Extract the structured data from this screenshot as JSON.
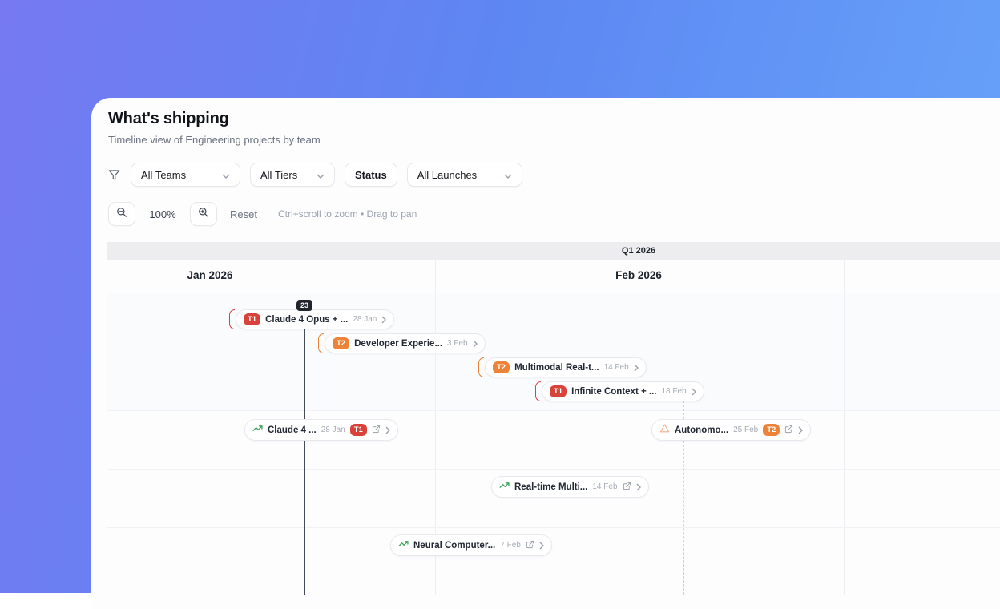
{
  "header": {
    "title": "What's shipping",
    "subtitle": "Timeline view of Engineering projects by team"
  },
  "filters": {
    "teams_label": "All Teams",
    "tiers_label": "All Tiers",
    "status_label": "Status",
    "launches_label": "All Launches"
  },
  "zoom_controls": {
    "level": "100%",
    "reset_label": "Reset",
    "hint": "Ctrl+scroll to zoom • Drag to pan"
  },
  "timeline": {
    "quarter_label": "Q1 2026",
    "months": [
      "Jan 2026",
      "Feb 2026"
    ],
    "today_label": "23",
    "projects": [
      {
        "tier": "T1",
        "name": "Claude 4 Opus + ...",
        "date": "28 Jan"
      },
      {
        "tier": "T2",
        "name": "Developer Experie...",
        "date": "3 Feb"
      },
      {
        "tier": "T2",
        "name": "Multimodal Real-t...",
        "date": "14 Feb"
      },
      {
        "tier": "T1",
        "name": "Infinite Context + ...",
        "date": "18 Feb"
      }
    ],
    "launches": [
      {
        "icon": "trending-up-icon",
        "name": "Claude 4 ...",
        "date": "28 Jan",
        "tier": "T1"
      },
      {
        "icon": "warning-triangle-icon",
        "name": "Autonomo...",
        "date": "25 Feb",
        "tier": "T2"
      },
      {
        "icon": "trending-up-icon",
        "name": "Real-time Multi...",
        "date": "14 Feb"
      },
      {
        "icon": "trending-up-icon",
        "name": "Neural Computer...",
        "date": "7 Feb"
      }
    ]
  },
  "icons": {
    "filter": "funnel",
    "zoom_out": "magnifier-minus",
    "zoom_in": "magnifier-plus",
    "dropdown": "chevron-down",
    "pill_end": "chevron-right",
    "external": "external-link"
  },
  "colors": {
    "tier1": "#d8423a",
    "tier2": "#ec8338",
    "trend_green": "#3da35a",
    "warning_amber": "#efad89",
    "today_line": "#454c59",
    "dashed_connector": "#f2c1bd",
    "gradient_start": "#7679f2",
    "gradient_end": "#68a6fb"
  }
}
